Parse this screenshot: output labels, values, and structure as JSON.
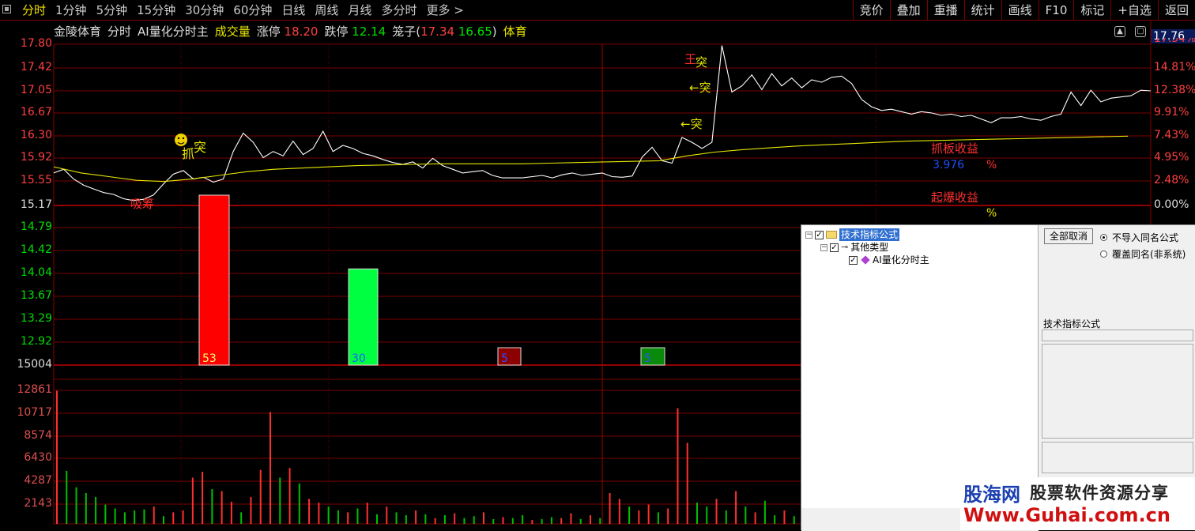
{
  "toolbar": {
    "tabs": [
      "分时",
      "1分钟",
      "5分钟",
      "15分钟",
      "30分钟",
      "60分钟",
      "日线",
      "周线",
      "月线",
      "多分时",
      "更多 >"
    ],
    "active_tab": "分时",
    "right_tools": [
      "竞价",
      "叠加",
      "重播",
      "统计",
      "画线",
      "F10",
      "标记",
      "+自选",
      "返回"
    ]
  },
  "info_bar": {
    "stock_name": "金陵体育",
    "mode": "分时",
    "formula": "AI量化分时主",
    "volume_label": "成交量",
    "limit_up_label": "涨停",
    "limit_up": "18.20",
    "limit_down_label": "跌停",
    "limit_down": "12.14",
    "cage_label": "笼子(",
    "cage_hi": "17.34",
    "cage_lo": "16.65",
    "cage_close": ")",
    "sector": "体育"
  },
  "current_price": "17.76",
  "price_axis": [
    "17.80",
    "17.42",
    "17.05",
    "16.67",
    "16.30",
    "15.92",
    "15.55",
    "15.17",
    "14.79",
    "14.42",
    "14.04",
    "13.67",
    "13.29",
    "12.92",
    "15004"
  ],
  "pct_axis": [
    "14.81%",
    "12.38%",
    "9.91%",
    "7.43%",
    "4.95%",
    "2.48%",
    "0.00%"
  ],
  "pct_axis_top_partial": "17.34%",
  "volume_axis": [
    "12861",
    "10717",
    "8574",
    "6430",
    "4287",
    "2143"
  ],
  "annotations": {
    "absorb": "吸筹",
    "grab": "抓",
    "breakout": "突",
    "breakout_arrow": "←突",
    "king": "王",
    "grab_profit_label": "抓板收益",
    "grab_profit_value": "3.976",
    "pct_sign": "%",
    "burst_profit_label": "起爆收益",
    "burst_pct_sign": "%"
  },
  "chart_data": {
    "type": "line",
    "title": "",
    "series": [
      {
        "name": "price",
        "color": "#ffffff",
        "values": [
          15.7,
          15.76,
          15.6,
          15.5,
          15.44,
          15.38,
          15.35,
          15.28,
          15.25,
          15.27,
          15.34,
          15.52,
          15.68,
          15.74,
          15.6,
          15.63,
          15.55,
          15.6,
          16.05,
          16.35,
          16.2,
          15.95,
          16.05,
          15.98,
          16.22,
          16.0,
          16.1,
          16.38,
          16.05,
          16.15,
          16.1,
          16.02,
          15.98,
          15.92,
          15.87,
          15.84,
          15.88,
          15.78,
          15.94,
          15.82,
          15.76,
          15.7,
          15.72,
          15.74,
          15.66,
          15.62,
          15.62,
          15.62,
          15.64,
          15.66,
          15.62,
          15.67,
          15.7,
          15.66,
          15.68,
          15.7,
          15.64,
          15.63,
          15.65,
          15.96,
          16.12,
          15.9,
          15.86,
          16.28,
          16.2,
          16.1,
          16.2,
          17.78,
          17.02,
          17.12,
          17.3,
          17.06,
          17.32,
          17.12,
          17.25,
          17.09,
          17.22,
          17.18,
          17.26,
          17.28,
          17.16,
          16.9,
          16.78,
          16.72,
          16.74,
          16.7,
          16.66,
          16.7,
          16.68,
          16.64,
          16.66,
          16.62,
          16.64,
          16.58,
          16.52,
          16.6,
          16.6,
          16.62,
          16.58,
          16.56,
          16.62,
          16.66,
          17.02,
          16.8,
          17.05,
          16.86,
          16.92,
          16.94,
          16.96,
          17.05,
          17.04
        ]
      },
      {
        "name": "avg",
        "color": "#e6e600",
        "values": [
          15.8,
          15.7,
          15.64,
          15.58,
          15.56,
          15.6,
          15.66,
          15.72,
          15.76,
          15.78,
          15.8,
          15.82,
          15.83,
          15.84,
          15.85,
          15.85,
          15.85,
          15.85,
          15.86,
          15.87,
          15.88,
          15.89,
          15.9,
          15.98,
          16.04,
          16.08,
          16.11,
          16.14,
          16.16,
          16.18,
          16.2,
          16.22,
          16.23,
          16.24,
          16.25,
          16.26,
          16.27,
          16.28,
          16.29,
          16.3
        ]
      }
    ],
    "signal_bars": [
      {
        "label": "53",
        "value": 53,
        "color": "#ff0000"
      },
      {
        "label": "30",
        "value": 30,
        "color": "#00ff40"
      },
      {
        "label": "5",
        "value": 5,
        "color": "#8b0000"
      },
      {
        "label": "5",
        "value": 5,
        "color": "#0a8a0a"
      }
    ],
    "volume": [
      {
        "value": 13800,
        "color": "#ff3030"
      },
      {
        "value": 5500,
        "color": "#00c000"
      },
      {
        "value": 3800,
        "color": "#00c000"
      },
      {
        "value": 3200,
        "color": "#00c000"
      },
      {
        "value": 2800,
        "color": "#00c000"
      },
      {
        "value": 2000,
        "color": "#00c000"
      },
      {
        "value": 1600,
        "color": "#00c000"
      },
      {
        "value": 1200,
        "color": "#00c000"
      },
      {
        "value": 1400,
        "color": "#00c000"
      },
      {
        "value": 1500,
        "color": "#00c000"
      },
      {
        "value": 1800,
        "color": "#ff3030"
      },
      {
        "value": 800,
        "color": "#00c000"
      },
      {
        "value": 1200,
        "color": "#ff3030"
      },
      {
        "value": 1400,
        "color": "#ff3030"
      },
      {
        "value": 4800,
        "color": "#ff3030"
      },
      {
        "value": 5400,
        "color": "#ff3030"
      },
      {
        "value": 3600,
        "color": "#00c000"
      },
      {
        "value": 3400,
        "color": "#ff3030"
      },
      {
        "value": 2300,
        "color": "#ff3030"
      },
      {
        "value": 1200,
        "color": "#00c000"
      },
      {
        "value": 2800,
        "color": "#ff3030"
      },
      {
        "value": 5600,
        "color": "#ff3030"
      },
      {
        "value": 11600,
        "color": "#ff3030"
      },
      {
        "value": 4800,
        "color": "#00c000"
      },
      {
        "value": 5800,
        "color": "#ff3030"
      },
      {
        "value": 4200,
        "color": "#00c000"
      },
      {
        "value": 2600,
        "color": "#ff3030"
      },
      {
        "value": 2200,
        "color": "#ff3030"
      },
      {
        "value": 1800,
        "color": "#00c000"
      },
      {
        "value": 1400,
        "color": "#00c000"
      },
      {
        "value": 1200,
        "color": "#ff3030"
      },
      {
        "value": 1600,
        "color": "#00c000"
      },
      {
        "value": 2200,
        "color": "#ff3030"
      },
      {
        "value": 1000,
        "color": "#00c000"
      },
      {
        "value": 1800,
        "color": "#ff3030"
      },
      {
        "value": 1200,
        "color": "#00c000"
      },
      {
        "value": 900,
        "color": "#00c000"
      },
      {
        "value": 1400,
        "color": "#ff3030"
      },
      {
        "value": 1000,
        "color": "#00c000"
      },
      {
        "value": 600,
        "color": "#ff3030"
      },
      {
        "value": 900,
        "color": "#00c000"
      },
      {
        "value": 1100,
        "color": "#ff3030"
      },
      {
        "value": 600,
        "color": "#00c000"
      },
      {
        "value": 800,
        "color": "#00c000"
      },
      {
        "value": 1200,
        "color": "#ff3030"
      },
      {
        "value": 500,
        "color": "#00c000"
      },
      {
        "value": 700,
        "color": "#ff3030"
      },
      {
        "value": 600,
        "color": "#00c000"
      },
      {
        "value": 900,
        "color": "#00c000"
      },
      {
        "value": 400,
        "color": "#ff3030"
      },
      {
        "value": 500,
        "color": "#00c000"
      },
      {
        "value": 700,
        "color": "#00c000"
      },
      {
        "value": 600,
        "color": "#ff3030"
      },
      {
        "value": 1100,
        "color": "#ff3030"
      },
      {
        "value": 500,
        "color": "#00c000"
      },
      {
        "value": 900,
        "color": "#ff3030"
      },
      {
        "value": 600,
        "color": "#00c000"
      },
      {
        "value": 3200,
        "color": "#ff3030"
      },
      {
        "value": 2600,
        "color": "#ff3030"
      },
      {
        "value": 1800,
        "color": "#00c000"
      },
      {
        "value": 1400,
        "color": "#ff3030"
      },
      {
        "value": 2000,
        "color": "#ff3030"
      },
      {
        "value": 1200,
        "color": "#00c000"
      },
      {
        "value": 1600,
        "color": "#ff3030"
      },
      {
        "value": 12000,
        "color": "#ff3030"
      },
      {
        "value": 8400,
        "color": "#ff3030"
      },
      {
        "value": 2200,
        "color": "#00c000"
      },
      {
        "value": 1800,
        "color": "#00c000"
      },
      {
        "value": 2600,
        "color": "#ff3030"
      },
      {
        "value": 1400,
        "color": "#00c000"
      },
      {
        "value": 3400,
        "color": "#ff3030"
      },
      {
        "value": 1800,
        "color": "#00c000"
      },
      {
        "value": 1200,
        "color": "#ff3030"
      },
      {
        "value": 2400,
        "color": "#00c000"
      },
      {
        "value": 900,
        "color": "#00c000"
      },
      {
        "value": 1400,
        "color": "#ff3030"
      },
      {
        "value": 800,
        "color": "#00c000"
      }
    ]
  },
  "dialog": {
    "tree": {
      "root": "技术指标公式",
      "child": "其他类型",
      "leaf": "AI量化分时主",
      "expand_symbol": "−",
      "check_symbol": "✓"
    },
    "cancel_all": "全部取消",
    "radio_no_import": "不导入同名公式",
    "radio_overwrite": "覆盖同名(非系统)",
    "formula_label": "技术指标公式"
  },
  "watermark": {
    "brand": "股海网",
    "tagline": "股票软件资源分享",
    "url": "Www.Guhai.com.cn"
  }
}
